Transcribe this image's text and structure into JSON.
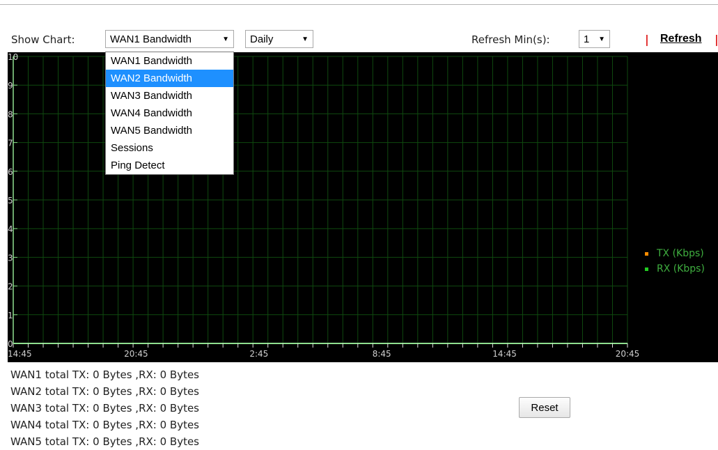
{
  "controls": {
    "show_chart_label": "Show Chart:",
    "chart_select_value": "WAN1 Bandwidth",
    "period_select_value": "Daily",
    "refresh_min_label": "Refresh Min(s):",
    "refresh_min_value": "1",
    "refresh_link": "Refresh",
    "separator": "|"
  },
  "dropdown": {
    "options": [
      "WAN1 Bandwidth",
      "WAN2 Bandwidth",
      "WAN3 Bandwidth",
      "WAN4 Bandwidth",
      "WAN5 Bandwidth",
      "Sessions",
      "Ping Detect"
    ],
    "highlighted_index": 1
  },
  "chart_data": {
    "type": "line",
    "y_ticks": [
      "0",
      "1",
      "2",
      "3",
      "4",
      "5",
      "6",
      "7",
      "8",
      "9",
      "10"
    ],
    "ylim": [
      0,
      10
    ],
    "x_tick_labels": [
      "14:45",
      "20:45",
      "2:45",
      "8:45",
      "14:45",
      "20:45"
    ],
    "grid": true,
    "background": "#000000",
    "grid_color": "#0f4a0f",
    "axis_color": "#8fe08f",
    "series": [
      {
        "name": "TX (Kbps)",
        "color": "#ff8c00",
        "values": []
      },
      {
        "name": "RX (Kbps)",
        "color": "#22cc22",
        "values": []
      }
    ],
    "legend_position": "right"
  },
  "totals": [
    "WAN1 total TX: 0 Bytes ,RX: 0 Bytes",
    "WAN2 total TX: 0 Bytes ,RX: 0 Bytes",
    "WAN3 total TX: 0 Bytes ,RX: 0 Bytes",
    "WAN4 total TX: 0 Bytes ,RX: 0 Bytes",
    "WAN5 total TX: 0 Bytes ,RX: 0 Bytes"
  ],
  "reset_label": "Reset"
}
